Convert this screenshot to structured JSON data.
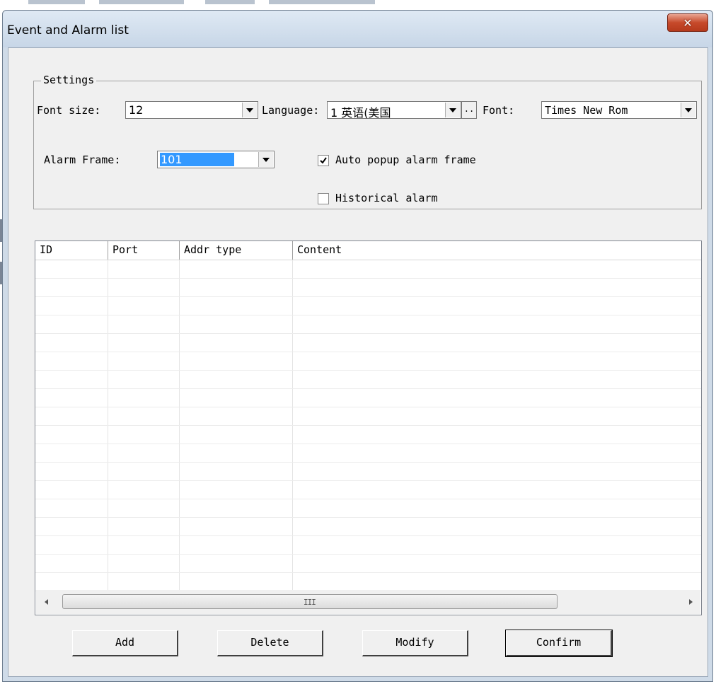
{
  "window": {
    "title": "Event and Alarm list",
    "close_icon": "close-icon"
  },
  "settings": {
    "group_label": "Settings",
    "font_size_label": "Font size:",
    "font_size_value": "12",
    "language_label": "Language:",
    "language_value": "1 英语(美国",
    "browse_label": "..",
    "font_label": "Font:",
    "font_value": "Times New Rom",
    "alarm_frame_label": "Alarm Frame:",
    "alarm_frame_value": "101",
    "auto_popup_label": "Auto popup alarm frame",
    "auto_popup_checked": true,
    "historical_label": "Historical alarm",
    "historical_checked": false
  },
  "list": {
    "columns": [
      "ID",
      "Port",
      "Addr type",
      "Content"
    ],
    "rows": []
  },
  "scrollbar": {
    "grip": "III"
  },
  "buttons": {
    "add": "Add",
    "delete": "Delete",
    "modify": "Modify",
    "confirm": "Confirm"
  },
  "colors": {
    "selection": "#3399ff",
    "close_button": "#c74a2b",
    "frame": "#cfdbe8"
  }
}
